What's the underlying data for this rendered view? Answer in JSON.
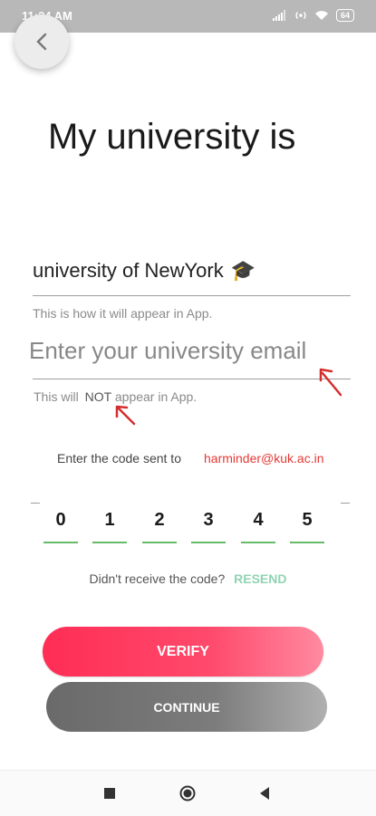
{
  "status_bar": {
    "time": "11:24 AM",
    "battery": "64"
  },
  "back_button": {
    "icon": "chevron-left-icon"
  },
  "title": "My university is",
  "university": {
    "name": "university of NewYork",
    "emoji": "🎓",
    "helper": "This is how it will appear in App."
  },
  "email_field": {
    "value": "",
    "placeholder": "Enter your university email",
    "helper_prefix": "This will",
    "helper_not": "NOT",
    "helper_suffix": "appear in App."
  },
  "code_section": {
    "label": "Enter the code sent to",
    "email": "harminder@kuk.ac.in",
    "digits": [
      "0",
      "1",
      "2",
      "3",
      "4",
      "5"
    ]
  },
  "resend": {
    "prompt": "Didn't receive the code?",
    "link": "RESEND"
  },
  "buttons": {
    "verify": "VERIFY",
    "continue": "CONTINUE"
  },
  "colors": {
    "accent": "#ff2d55",
    "email_red": "#e53935",
    "resend_green": "#8fd4b1",
    "otp_underline": "#66bb6a",
    "continue_gray": "#6a6a6a"
  },
  "nav_bar": {
    "icons": [
      "square-icon",
      "circle-icon",
      "back-triangle-icon"
    ]
  }
}
